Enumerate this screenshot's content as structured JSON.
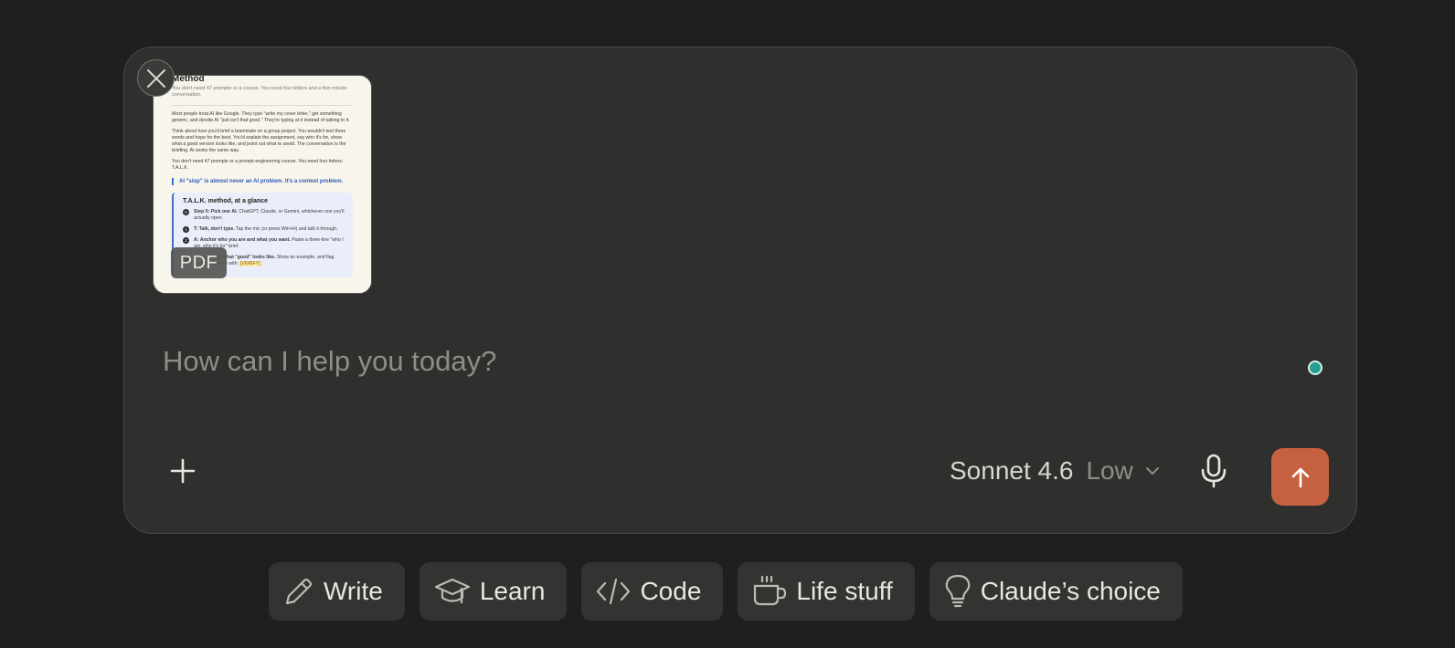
{
  "attachment": {
    "type_badge": "PDF",
    "preview": {
      "title": "Method",
      "subtitle": "You don't need 47 prompts or a course. You need four letters and a five-minute conversation.",
      "paragraphs": [
        "Most people treat AI like Google. They type \"write my cover letter,\" get something generic, and decide AI \"just isn't that good.\" They're typing at it instead of talking to it.",
        "Think about how you'd brief a teammate on a group project. You wouldn't text three words and hope for the best. You'd explain the assignment, say who it's for, show what a good version looks like, and point out what to avoid. The conversation is the briefing. AI works the same way.",
        "You don't need 47 prompts or a prompt-engineering course. You need four letters: T.A.L.K."
      ],
      "callout": "AI \"slop\" is almost never an AI problem. It's a context problem.",
      "box_title": "T.A.L.K. method, at a glance",
      "steps": [
        {
          "num": "0",
          "bold": "Step 0: Pick one AI.",
          "text": "ChatGPT, Claude, or Gemini, whichever one you'll actually open."
        },
        {
          "num": "1",
          "bold": "T: Talk, don't type.",
          "text": "Tap the mic (or press Win+H) and talk it through."
        },
        {
          "num": "2",
          "bold": "A: Anchor who you are and what you want.",
          "text": "Paste a three-line \"who I am, who it's for\" brief."
        },
        {
          "num": "4",
          "bold": "L: Load with what \"good\" looks like.",
          "text": "Show an example, and flag anything unsure with",
          "tag": "[VERIFY]"
        }
      ]
    }
  },
  "input": {
    "placeholder": "How can I help you today?",
    "value": ""
  },
  "toolbar": {
    "model_name": "Sonnet 4.6",
    "effort": "Low"
  },
  "chips": [
    {
      "label": "Write",
      "icon": "pencil-icon"
    },
    {
      "label": "Learn",
      "icon": "graduation-cap-icon"
    },
    {
      "label": "Code",
      "icon": "code-icon"
    },
    {
      "label": "Life stuff",
      "icon": "coffee-cup-icon"
    },
    {
      "label": "Claude’s choice",
      "icon": "lightbulb-icon"
    }
  ],
  "colors": {
    "background": "#1f1f1e",
    "composer": "#2f2f2d",
    "send_button": "#c6613f",
    "status_dot": "#23a08e"
  }
}
